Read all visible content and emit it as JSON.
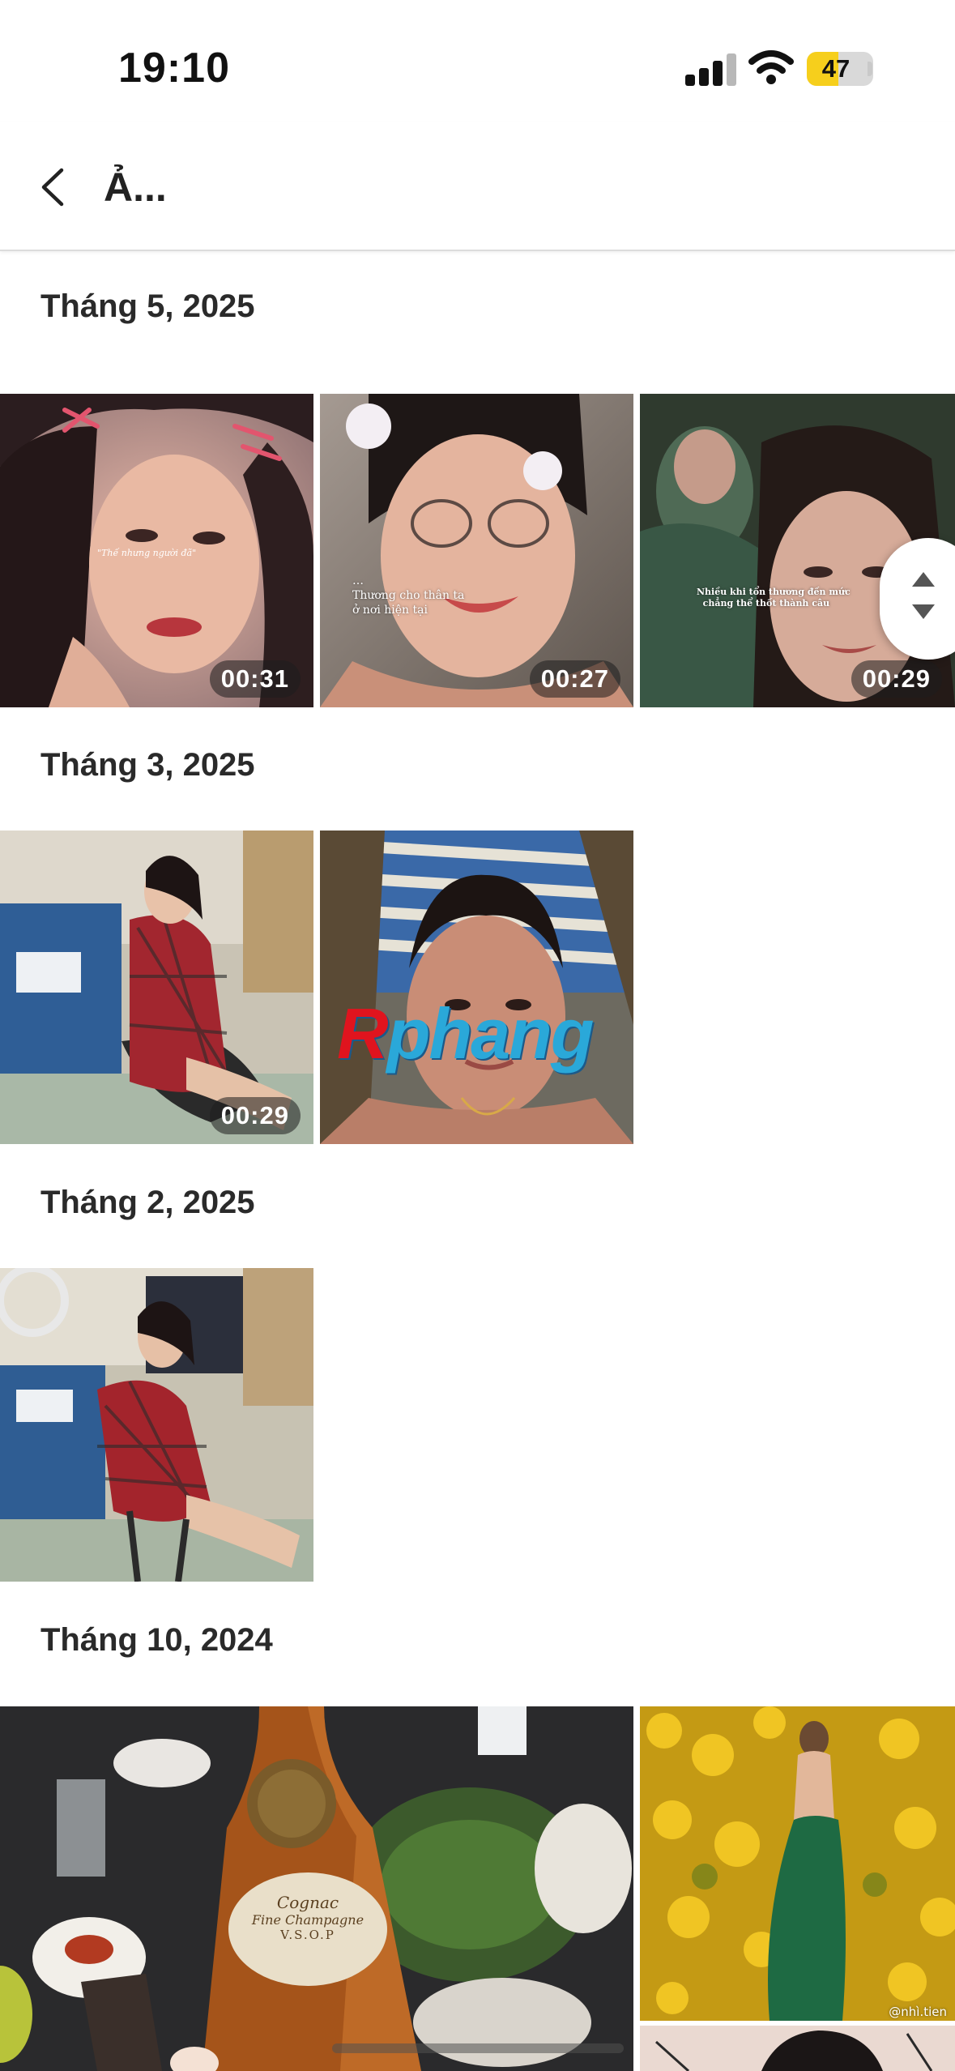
{
  "status_bar": {
    "time": "19:10",
    "battery_level": "47",
    "battery_fraction": 0.47,
    "icons": [
      "signal-icon",
      "wifi-icon",
      "battery-icon"
    ]
  },
  "nav": {
    "back_icon": "chevron-left-icon",
    "title": "Ả..."
  },
  "sections": [
    {
      "title": "Tháng 5, 2025",
      "items": [
        {
          "type": "video",
          "duration": "00:31",
          "caption": "\"Thế nhưng người đã\""
        },
        {
          "type": "video",
          "duration": "00:27",
          "caption": "Thương cho thân ta\nở nơi hiện tại"
        },
        {
          "type": "video",
          "duration": "00:29",
          "caption": "Nhiều khi tổn thương đến mức\nchẳng thể thốt thành câu"
        }
      ]
    },
    {
      "title": "Tháng 3, 2025",
      "items": [
        {
          "type": "video",
          "duration": "00:29"
        },
        {
          "type": "photo",
          "watermark": "Rphang"
        }
      ]
    },
    {
      "title": "Tháng 2, 2025",
      "items": [
        {
          "type": "photo"
        }
      ]
    },
    {
      "title": "Tháng 10, 2024",
      "items": [
        {
          "type": "photo",
          "label_line1": "Cognac",
          "label_line2": "Fine Champagne",
          "label_line3": "V.S.O.P"
        },
        {
          "type": "photo",
          "caption": "@nhì.tien"
        },
        {
          "type": "photo"
        }
      ]
    }
  ],
  "scroll_handle_icon": "scroll-up-down-icon",
  "colors": {
    "background": "#ffffff",
    "battery_fill": "#f6cf1c",
    "divider": "#dcdcdc"
  }
}
